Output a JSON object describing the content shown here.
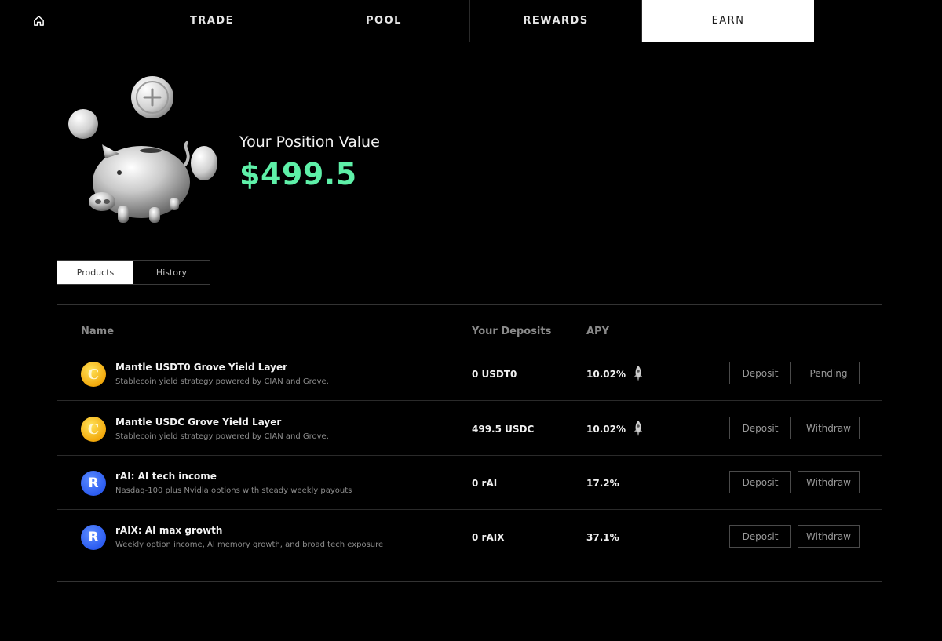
{
  "nav": {
    "tabs": [
      {
        "label": "TRADE"
      },
      {
        "label": "POOL"
      },
      {
        "label": "REWARDS"
      },
      {
        "label": "EARN",
        "active": true
      }
    ]
  },
  "hero": {
    "title": "Your Position Value",
    "value": "$499.5",
    "value_color": "#5ef0a8"
  },
  "segments": [
    {
      "label": "Products",
      "active": true
    },
    {
      "label": "History"
    }
  ],
  "table": {
    "headers": {
      "name": "Name",
      "deposits": "Your Deposits",
      "apy": "APY"
    },
    "rows": [
      {
        "icon": "cian-token-icon",
        "name": "Mantle USDT0 Grove Yield Layer",
        "desc": "Stablecoin yield strategy powered by CIAN and Grove.",
        "deposit": "0 USDT0",
        "apy": "10.02%",
        "rocket": true,
        "btn1": "Deposit",
        "btn2": "Pending"
      },
      {
        "icon": "cian-token-icon",
        "name": "Mantle USDC Grove Yield Layer",
        "desc": "Stablecoin yield strategy powered by CIAN and Grove.",
        "deposit": "499.5 USDC",
        "apy": "10.02%",
        "rocket": true,
        "btn1": "Deposit",
        "btn2": "Withdraw"
      },
      {
        "icon": "r-token-icon",
        "name": "rAI: AI tech income",
        "desc": "Nasdaq-100 plus Nvidia options with steady weekly payouts",
        "deposit": "0 rAI",
        "apy": "17.2%",
        "rocket": false,
        "btn1": "Deposit",
        "btn2": "Withdraw"
      },
      {
        "icon": "r-token-icon",
        "name": "rAIX: AI max growth",
        "desc": "Weekly option income, AI memory growth, and broad tech exposure",
        "deposit": "0 rAIX",
        "apy": "37.1%",
        "rocket": false,
        "btn1": "Deposit",
        "btn2": "Withdraw"
      }
    ]
  }
}
